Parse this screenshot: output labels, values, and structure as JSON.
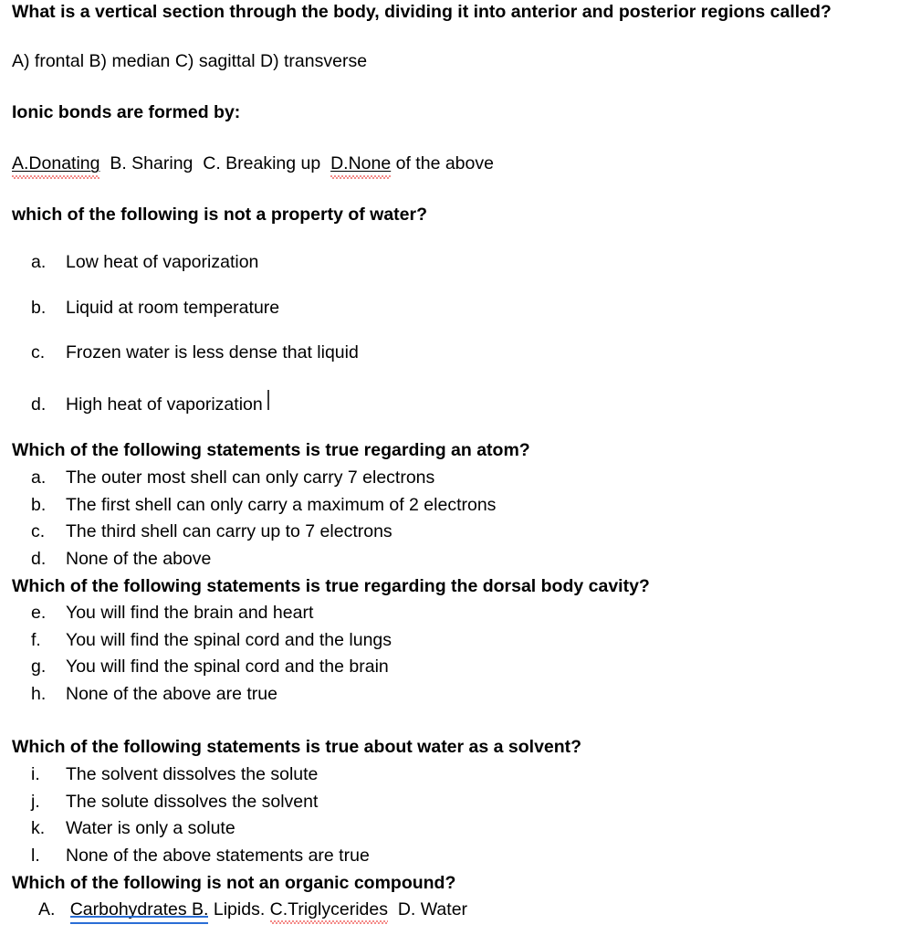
{
  "document": {
    "background_color": "#ffffff",
    "text_color": "#000000",
    "spellcheck_color": "#e8140f",
    "grammarcheck_color": "#2a6ed6",
    "caret_color": "#3a3a3a"
  },
  "questions": [
    {
      "id": "q1",
      "prompt": "What is a vertical section through the body, dividing it into anterior and posterior regions called?",
      "answers_inline": "A) frontal   B) median   C) sagittal   D) transverse",
      "options": [
        {
          "marker": "A)",
          "label": "frontal"
        },
        {
          "marker": "B)",
          "label": "median"
        },
        {
          "marker": "C)",
          "label": "sagittal"
        },
        {
          "marker": "D)",
          "label": "transverse"
        }
      ]
    },
    {
      "id": "q2",
      "prompt": "Ionic bonds are formed by:",
      "options": [
        {
          "marker": "A.",
          "label": "Donating",
          "combined": "A.Donating",
          "proofing": "spelling-underline"
        },
        {
          "marker": "B.",
          "label": "Sharing",
          "combined": "B. Sharing",
          "proofing": "none"
        },
        {
          "marker": "C.",
          "label": "Breaking up",
          "combined": "C. Breaking up",
          "proofing": "none"
        },
        {
          "marker": "D.",
          "label": "None",
          "combined": "D.None",
          "trailing": "of the above",
          "proofing": "spelling-underline"
        }
      ]
    },
    {
      "id": "q3",
      "prompt": "which of the following is not a property of water?",
      "spacing": "loose",
      "options": [
        {
          "marker": "a.",
          "label": "Low heat of vaporization"
        },
        {
          "marker": "b.",
          "label": "Liquid at room temperature"
        },
        {
          "marker": "c.",
          "label": "Frozen water is less dense that liquid"
        },
        {
          "marker": "d.",
          "label": "High heat of vaporization",
          "caret": true
        }
      ]
    },
    {
      "id": "q4",
      "prompt": "Which of the following statements is true regarding an atom?",
      "spacing": "tight",
      "options": [
        {
          "marker": "a.",
          "label": "The outer most shell can only carry 7 electrons"
        },
        {
          "marker": "b.",
          "label": "The first shell can only carry a maximum of 2 electrons"
        },
        {
          "marker": "c.",
          "label": "The third shell can carry up to 7 electrons"
        },
        {
          "marker": "d.",
          "label": "None of the above"
        }
      ]
    },
    {
      "id": "q5",
      "prompt": "Which of the following statements is true regarding the dorsal body cavity?",
      "spacing": "tight",
      "options": [
        {
          "marker": "e.",
          "label": "You will find the brain and heart"
        },
        {
          "marker": "f.",
          "label": "You will find the spinal cord and the lungs"
        },
        {
          "marker": "g.",
          "label": "You will find the spinal cord and the brain"
        },
        {
          "marker": "h.",
          "label": "None of the above are true"
        }
      ]
    },
    {
      "id": "q6",
      "prompt": "Which of the following statements is true about water as a solvent?",
      "spacing": "tight",
      "options": [
        {
          "marker": "i.",
          "label": "The solvent dissolves the solute"
        },
        {
          "marker": "j.",
          "label": "The solute dissolves the solvent"
        },
        {
          "marker": "k.",
          "label": "Water is only a solute"
        },
        {
          "marker": "l.",
          "label": "None of the above statements are true"
        }
      ]
    },
    {
      "id": "q7",
      "prompt": "Which of the following is not an organic compound?",
      "spacing": "tight",
      "options": [
        {
          "marker": "A.",
          "label": "Carbohydrates",
          "proofing": "grammar-underline"
        },
        {
          "marker": "B.",
          "label": "Lipids.",
          "proofing": "grammar-underline"
        },
        {
          "marker": "C.",
          "label": "Triglycerides",
          "combined": "C.Triglycerides",
          "proofing": "spelling-squiggle"
        },
        {
          "marker": "D.",
          "label": "Water",
          "proofing": "none"
        }
      ]
    }
  ],
  "inline_runs": {
    "q2_a": "A.Donating",
    "q2_b": "B. Sharing",
    "q2_c": "C. Breaking up",
    "q2_d_underlined": "D.None",
    "q2_d_rest": " of the above",
    "q7_marker_a": "A.",
    "q7_grammar_run": "Carbohydrates  B.",
    "q7_lipids": " Lipids.",
    "q7_triglycerides": "C.Triglycerides",
    "q7_water": "D. Water"
  }
}
